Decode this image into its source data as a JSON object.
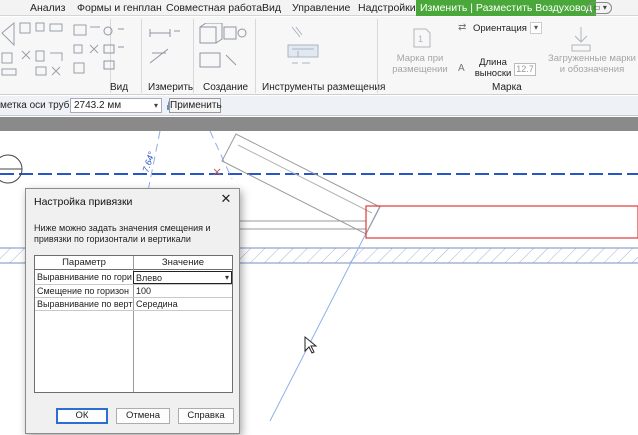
{
  "ribbon": {
    "tabs": [
      "Анализ",
      "Формы и генплан",
      "Совместная работа",
      "Вид",
      "Управление",
      "Надстройки",
      "Изменить | Разместить Воздуховод"
    ],
    "panels": {
      "view": "Вид",
      "measure": "Измерить",
      "create": "Создание",
      "placement_tools": "Инструменты размещения",
      "tag": "Марка"
    },
    "tag_on_placement": "Марка при размещении",
    "orientation": "Ориентация",
    "leader_length": "Длина выноски",
    "leader_value": "12.7",
    "loaded_tags": "Загруженные марки и обозначения"
  },
  "options_bar": {
    "label": "метка оси трубы:",
    "value": "2743.2 мм",
    "apply_label": "Применить"
  },
  "canvas": {
    "axis_label": "7.64°"
  },
  "dialog": {
    "title": "Настройка привязки",
    "description": "Ниже можно задать значения смещения и привязки по горизонтали и вертикали",
    "columns": [
      "Параметр",
      "Значение"
    ],
    "rows": [
      {
        "param": "Выравнивание по гори",
        "value": "Влево"
      },
      {
        "param": "Смещение по горизон",
        "value": "100"
      },
      {
        "param": "Выравнивание по верт",
        "value": "Середина"
      }
    ],
    "ok_label": "ОК",
    "cancel_label": "Отмена",
    "help_label": "Справка"
  },
  "colors": {
    "active_tab": "#4aa83a",
    "axis_blue": "#2a55c8",
    "duct_red": "#e03a3a"
  }
}
